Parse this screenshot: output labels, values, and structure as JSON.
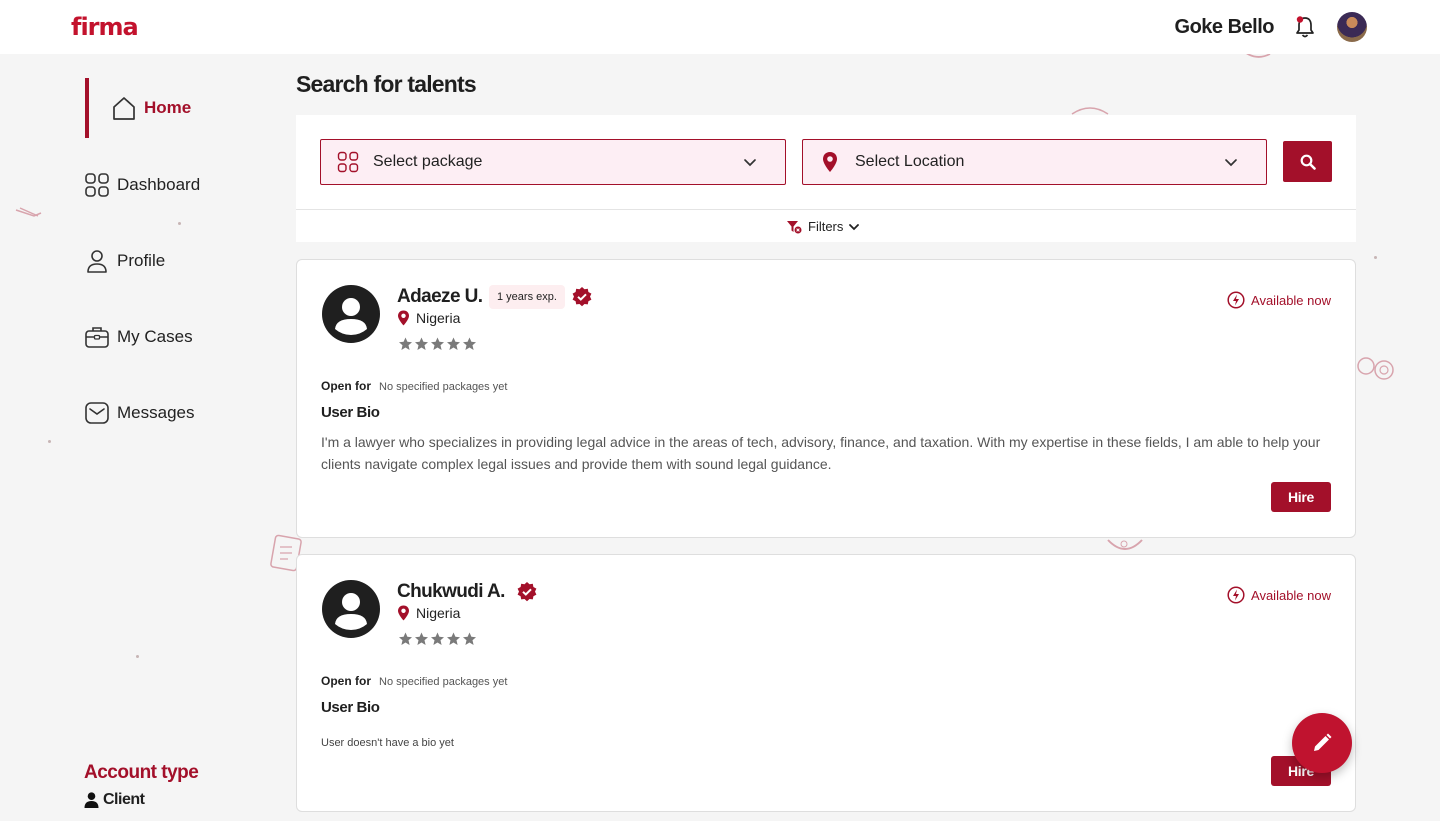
{
  "brand": {
    "logo_text": "firma",
    "accent": "#a3102a"
  },
  "header": {
    "user_name": "Goke Bello"
  },
  "sidebar": {
    "items": [
      {
        "label": "Home",
        "icon": "home-icon",
        "active": true
      },
      {
        "label": "Dashboard",
        "icon": "grid-icon",
        "active": false
      },
      {
        "label": "Profile",
        "icon": "user-icon",
        "active": false
      },
      {
        "label": "My Cases",
        "icon": "briefcase-icon",
        "active": false
      },
      {
        "label": "Messages",
        "icon": "envelope-icon",
        "active": false
      }
    ],
    "account_type_title": "Account type",
    "account_type_value": "Client"
  },
  "main": {
    "title": "Search for talents",
    "search": {
      "package_placeholder": "Select package",
      "location_placeholder": "Select Location",
      "filters_label": "Filters"
    },
    "talents": [
      {
        "name": "Adaeze U.",
        "experience": "1 years exp.",
        "location": "Nigeria",
        "availability": "Available now",
        "open_for_label": "Open for",
        "open_for_value": "No specified packages yet",
        "bio_title": "User Bio",
        "bio": "I'm a lawyer who specializes in providing legal advice in the areas of tech, advisory, finance, and taxation. With my expertise in these fields, I am able to help your clients navigate complex legal issues and provide them with sound legal guidance.",
        "hire_label": "Hire",
        "rating": 0
      },
      {
        "name": "Chukwudi A.",
        "experience": "",
        "location": "Nigeria",
        "availability": "Available now",
        "open_for_label": "Open for",
        "open_for_value": "No specified packages yet",
        "bio_title": "User Bio",
        "bio": "User doesn't have a bio yet",
        "hire_label": "Hire",
        "rating": 0
      }
    ]
  }
}
